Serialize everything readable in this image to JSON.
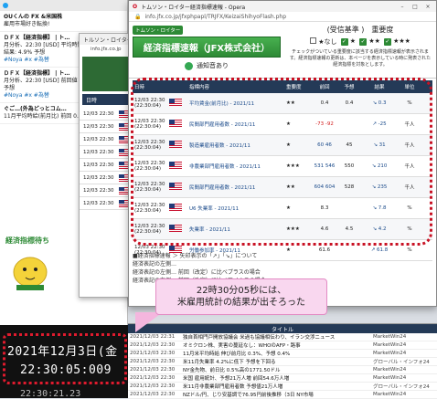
{
  "bg_app": {
    "feed": [
      {
        "title": "OUくんの FX &米国株",
        "text": "雇用市場好き転換!",
        "hash": ""
      },
      {
        "title": "ＤＦＸ【経済指標】 | ト…",
        "text": "月分析、22:30 [USD] 平均時間労所 11月(前回結果: 4.9% 予想",
        "hash": "#Noya #x #為替"
      },
      {
        "title": "ＤＦＸ【経済指標】 | ト…",
        "text": "月分析、22:30 [USD] 前回値 前回結果: 0.4% 予想",
        "hash": "#Noya #x #為替"
      },
      {
        "title": "ぐご…(外為どっとコム…",
        "text": "11月平均時給(前月比) 前回 0.4%",
        "hash": ""
      }
    ],
    "mascot_label": "経済指標待ち"
  },
  "clock": {
    "date": "2021年12月3日(金",
    "time": "22:30:05:009",
    "next": "22:30:21.23"
  },
  "mid_window": {
    "tab": "トルソン・ロイター",
    "url": "info.jfx.co.jp",
    "thead": "日時",
    "rows": [
      "12/03 22:30",
      "12/03 22:30",
      "12/03 22:30",
      "12/03 22:30",
      "12/03 22:30",
      "12/03 22:30",
      "12/03 22:30",
      "12/03 22:30"
    ]
  },
  "main_window": {
    "tab_title": "トムソン・ロイター経済指標速報 - Opera",
    "url": "info.jfx.co.jp/jfxphpapl/TRJFX/KeizaiShihyoFlash.php",
    "brand_tag": "トムソン・ロイター",
    "indicator_title": "経済指標速報（JFX株式会社）",
    "sound_label": "通知音あり",
    "importance": {
      "title": "(受信基準 )　重要度",
      "levels": [
        "★なし",
        "★",
        "★★",
        "★★★"
      ],
      "note": "チェックがついている重要度に該当する経済指標速報が表示されます。経済指標速報の更新は、本ページを表示している時に発表された経済指標を対象とします。"
    },
    "columns": [
      "日時",
      "",
      "指標内容",
      "重要度",
      "前回",
      "予想",
      "結果",
      "単位"
    ],
    "rows": [
      {
        "dt": "12/03 22:30 (22:30:04)",
        "name": "平均賃金(前月比) - 2021/11",
        "imp": "★★",
        "prev": "0.4",
        "fc": "0.4",
        "res": "↘ 0.3",
        "unit": "%"
      },
      {
        "dt": "12/03 22:30 (22:30:04)",
        "name": "民間部門雇用者数 - 2021/11",
        "imp": "★",
        "prev": "-73 -92",
        "fc": "",
        "res": "↗ -25",
        "unit": "千人"
      },
      {
        "dt": "12/03 22:30 (22:30:04)",
        "name": "製造業雇用者数 - 2021/11",
        "imp": "★",
        "prev": "60 46",
        "fc": "45",
        "res": "↘ 31",
        "unit": "千人"
      },
      {
        "dt": "12/03 22:30 (22:30:04)",
        "name": "非農業部門雇用者数 - 2021/11",
        "imp": "★★★",
        "prev": "531 546",
        "fc": "550",
        "res": "↘ 210",
        "unit": "千人"
      },
      {
        "dt": "12/03 22:30 (22:30:04)",
        "name": "民間部門雇用者数 - 2021/11",
        "imp": "★★",
        "prev": "604 604",
        "fc": "528",
        "res": "↘ 235",
        "unit": "千人"
      },
      {
        "dt": "12/03 22:30 (22:30:04)",
        "name": "U6 失業率 - 2021/11",
        "imp": "★",
        "prev": "8.3",
        "fc": "",
        "res": "↘ 7.8",
        "unit": "%"
      },
      {
        "dt": "12/03 22:30 (22:30:04)",
        "name": "失業率 - 2021/11",
        "imp": "★★★",
        "prev": "4.6",
        "fc": "4.5",
        "res": "↘ 4.2",
        "unit": "%"
      },
      {
        "dt": "12/03 22:30 (22:30:04)",
        "name": "労働参加率 - 2021/11",
        "imp": "★",
        "prev": "61.6",
        "fc": "",
        "res": "↗ 61.8",
        "unit": "%"
      }
    ],
    "notes": [
      "■経済指標速報 ＞ 矢印表示の「↗」「↘」について",
      "経済表記の左側…",
      "経済表記の左側… 前回（改定）に比べプラスの場合",
      "経済表記の左側… 前回（改定）に比べマイナスの場合"
    ]
  },
  "callout": {
    "line1": "22時30分05秒には、",
    "line2": "米雇用統計の結果が出そろった"
  },
  "news": {
    "header": "タイトル",
    "rows": [
      {
        "t": "2021/12/03 22:31",
        "h": "独自首相門戸開放協議会 米過も協議相伝わり、イラン交渉ニュース",
        "s": "MarketWin24"
      },
      {
        "t": "2021/12/03 22:30",
        "h": "オミクロン株、実害の蔓延なし：WHOのAFP・路事",
        "s": "MarketWin24"
      },
      {
        "t": "2021/12/03 22:30",
        "h": "11月米平均時給 伸び前月比 0.3%、予想 0.4%",
        "s": "MarketWin24"
      },
      {
        "t": "2021/12/03 22:30",
        "h": "米11月失業率 4.2%に低下 予想を下回る",
        "s": "グローバル・インフォ24"
      },
      {
        "t": "2021/12/03 22:30",
        "h": "NY金先物、前日比 0.5%高の1771.50ドル",
        "s": "MarketWin24"
      },
      {
        "t": "2021/12/03 22:30",
        "h": "米国 雇用統計、予想21万人増 前回54.6万人増",
        "s": "MarketWin24"
      },
      {
        "t": "2021/12/03 22:30",
        "h": "米11月非農業部門雇用者数 予想値21万人増",
        "s": "グローバル・インフォ24"
      },
      {
        "t": "2021/12/03 22:30",
        "h": "NZドル/円、じり安基調で76.95円前後推移（3日 NY市場",
        "s": "MarketWin24"
      },
      {
        "t": "2021/12/03 22:30",
        "h": "【指標発表予定】 22:30 11月米雇用統計",
        "s": "グローバル・インフォ24"
      }
    ]
  }
}
